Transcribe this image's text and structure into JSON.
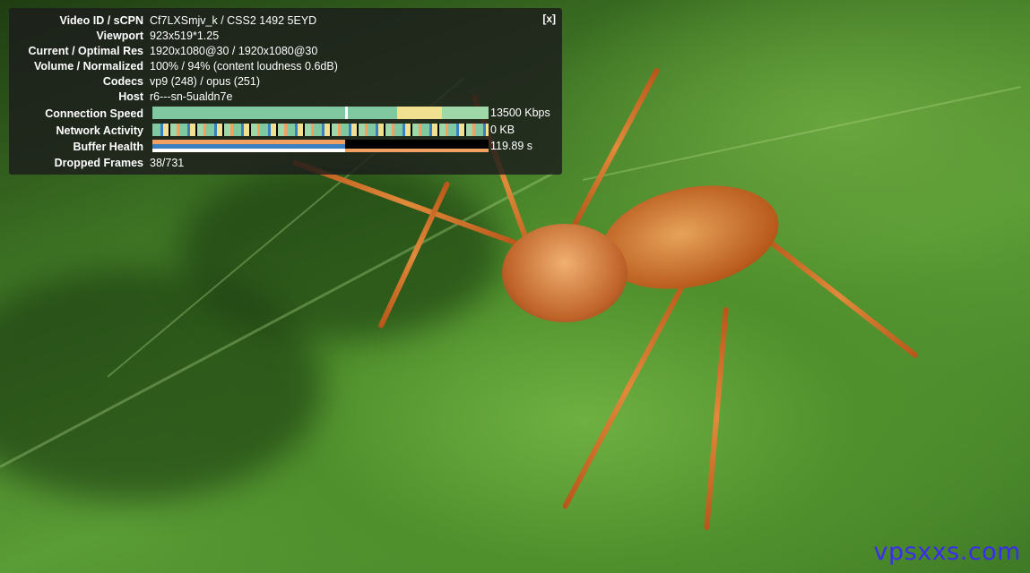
{
  "stats": {
    "close_label": "[x]",
    "rows": [
      {
        "label": "Video ID / sCPN",
        "value": "Cf7LXSmjv_k / CSS2 1492 5EYD"
      },
      {
        "label": "Viewport",
        "value": "923x519*1.25"
      },
      {
        "label": "Current / Optimal Res",
        "value": "1920x1080@30 / 1920x1080@30"
      },
      {
        "label": "Volume / Normalized",
        "value": "100% / 94% (content loudness 0.6dB)"
      },
      {
        "label": "Codecs",
        "value": "vp9 (248) / opus (251)"
      },
      {
        "label": "Host",
        "value": "r6---sn-5ualdn7e"
      }
    ],
    "connection_speed": {
      "label": "Connection Speed",
      "value": "13500 Kbps"
    },
    "network_activity": {
      "label": "Network Activity",
      "value": "0 KB"
    },
    "buffer_health": {
      "label": "Buffer Health",
      "value": "119.89 s"
    },
    "dropped_frames": {
      "label": "Dropped Frames",
      "value": "38/731"
    }
  },
  "graph_colors": {
    "green": "#7fc8a0",
    "yellow": "#f0e090",
    "orange": "#f0a060",
    "blue": "#3a7fc0",
    "white": "#ffffff",
    "black": "#000000"
  },
  "watermark": "vpsxxs.com"
}
